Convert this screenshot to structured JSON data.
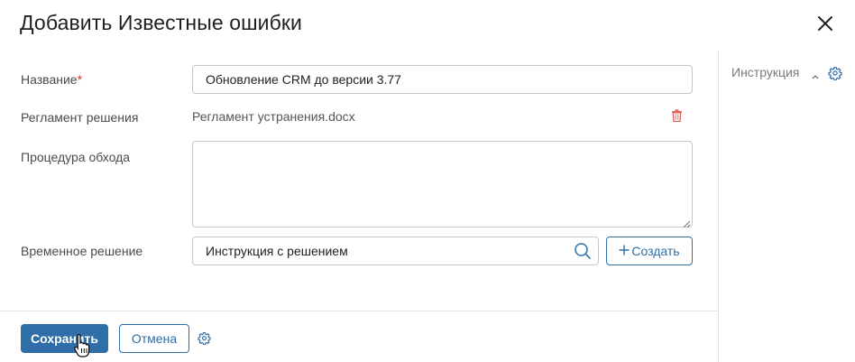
{
  "dialog": {
    "title": "Добавить Известные ошибки"
  },
  "form": {
    "name": {
      "label": "Название",
      "required_mark": "*",
      "value": "Обновление CRM до версии 3.77"
    },
    "regulation": {
      "label": "Регламент решения",
      "file": "Регламент устранения.docx"
    },
    "workaround": {
      "label": "Процедура обхода",
      "value": ""
    },
    "temp_solution": {
      "label": "Временное решение",
      "value": "Инструкция с решением",
      "create_label": "Создать"
    }
  },
  "sidebar": {
    "title": "Инструкция"
  },
  "footer": {
    "save_label": "Сохранить",
    "cancel_label": "Отмена"
  },
  "colors": {
    "accent": "#2e6fa8",
    "required": "#d0342c",
    "delete": "#e0625a"
  },
  "icons": [
    "close-icon",
    "trash-icon",
    "search-icon",
    "plus-icon",
    "chevron-up-icon",
    "gear-icon",
    "hand-cursor-icon"
  ]
}
